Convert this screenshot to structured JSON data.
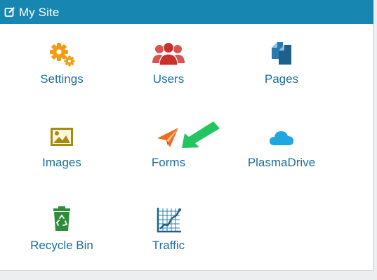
{
  "header": {
    "title": "My Site",
    "icon": "edit-icon"
  },
  "colors": {
    "header_bg": "#1786b0",
    "label": "#1a6f9b",
    "settings": "#f39c12",
    "users": "#d9534f",
    "pages": "#1f5f8b",
    "images": "#a78a12",
    "forms": "#f06a1e",
    "plasmadrive": "#1ea7e1",
    "recycle": "#2f8c3a",
    "traffic": "#2d7fb5",
    "annotation_arrow": "#22c55e"
  },
  "tiles": [
    {
      "label": "Settings",
      "icon": "gears-icon"
    },
    {
      "label": "Users",
      "icon": "users-icon"
    },
    {
      "label": "Pages",
      "icon": "pages-icon"
    },
    {
      "label": "Images",
      "icon": "image-icon"
    },
    {
      "label": "Forms",
      "icon": "paper-plane-icon"
    },
    {
      "label": "PlasmaDrive",
      "icon": "cloud-icon"
    },
    {
      "label": "Recycle Bin",
      "icon": "recycle-bin-icon"
    },
    {
      "label": "Traffic",
      "icon": "traffic-chart-icon"
    }
  ],
  "annotation": {
    "icon": "green-arrow-icon"
  }
}
